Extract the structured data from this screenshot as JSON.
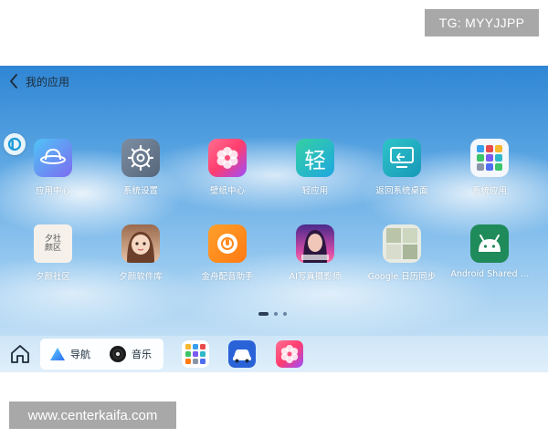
{
  "watermarks": {
    "tg": "TG: MYYJJPP",
    "site": "www.centerkaifa.com"
  },
  "header": {
    "title": "我的应用"
  },
  "apps": [
    {
      "label": "应用中心",
      "icon": "app-center-icon"
    },
    {
      "label": "系统设置",
      "icon": "gear-icon"
    },
    {
      "label": "壁纸中心",
      "icon": "wallpaper-flower-icon"
    },
    {
      "label": "轻应用",
      "icon": "light-app-icon",
      "glyph": "轻"
    },
    {
      "label": "返回系统桌面",
      "icon": "desktop-return-icon"
    },
    {
      "label": "系统应用",
      "icon": "system-apps-grid-icon"
    },
    {
      "label": "夕颜社区",
      "icon": "xiyan-community-icon",
      "glyph": "夕社\n颜区"
    },
    {
      "label": "夕颜软件库",
      "icon": "anime-girl-icon"
    },
    {
      "label": "金舟配音助手",
      "icon": "dubbing-assistant-icon"
    },
    {
      "label": "AI写真摄影师",
      "icon": "ai-portrait-icon"
    },
    {
      "label": "Google 日历同步",
      "icon": "google-calendar-sync-icon"
    },
    {
      "label": "Android Shared ...",
      "icon": "android-icon"
    }
  ],
  "pager": {
    "pages": 3,
    "current": 1
  },
  "dock": {
    "nav_label": "导航",
    "music_label": "音乐",
    "apps": [
      "app-grid-icon",
      "car-icon",
      "wallpaper-flower-icon"
    ]
  },
  "colors": {
    "sky_top": "#2f86d4",
    "sky_bottom": "#cfe6f7",
    "label": "#ffffff"
  }
}
